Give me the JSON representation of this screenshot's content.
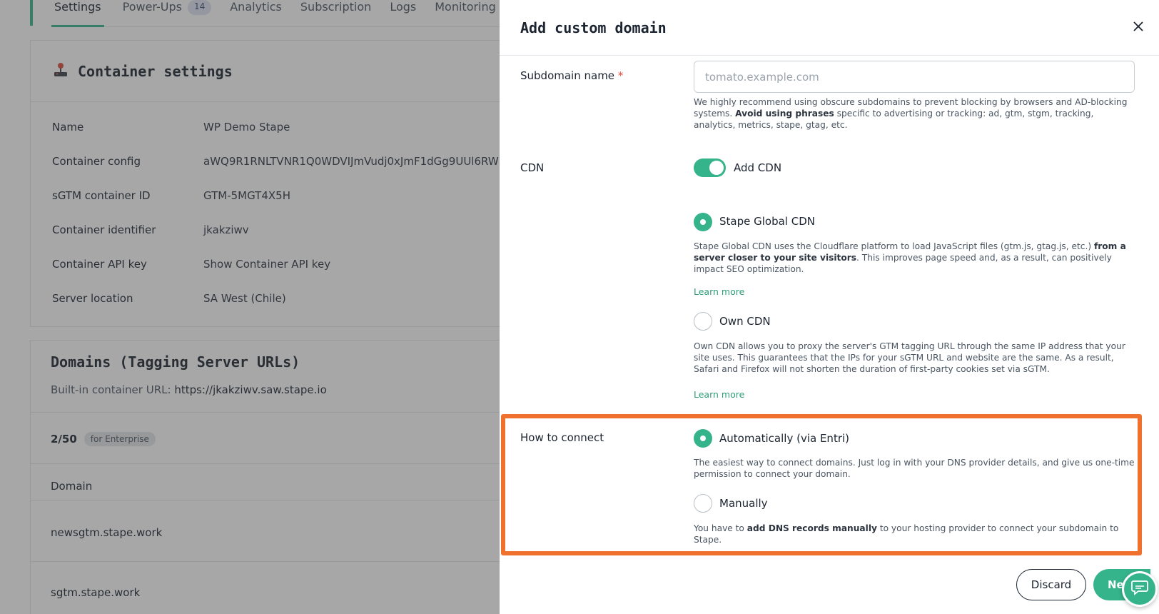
{
  "background": {
    "tabs": [
      {
        "label": "Settings",
        "active": true
      },
      {
        "label": "Power-Ups",
        "count": "14"
      },
      {
        "label": "Analytics"
      },
      {
        "label": "Subscription"
      },
      {
        "label": "Logs"
      },
      {
        "label": "Monitoring"
      }
    ],
    "container_settings": {
      "title": "Container settings",
      "rows": [
        {
          "key": "Name",
          "value": "WP Demo Stape"
        },
        {
          "key": "Container config",
          "value": "aWQ9R1RNLTVNR1Q0WDVIJmVudj0xJmF1dGg9UUl6RW"
        },
        {
          "key": "sGTM container ID",
          "value": "GTM-5MGT4X5H"
        },
        {
          "key": "Container identifier",
          "value": "jkakziwv"
        },
        {
          "key": "Container API key",
          "value": "Show Container API key"
        },
        {
          "key": "Server location",
          "value": "SA West (Chile)"
        }
      ]
    },
    "domains": {
      "title": "Domains (Tagging Server URLs)",
      "builtin_label": "Built-in container URL:",
      "builtin_url": "https://jkakziwv.saw.stape.io",
      "usage": "2/50",
      "plan_badge": "for Enterprise",
      "column_header": "Domain",
      "items": [
        "newsgtm.stape.work",
        "sgtm.stape.work"
      ]
    }
  },
  "modal": {
    "title": "Add custom domain",
    "subdomain": {
      "label": "Subdomain name",
      "required_mark": "*",
      "placeholder": "tomato.example.com",
      "value": "",
      "help_pre": "We highly recommend using obscure subdomains to prevent blocking by browsers and AD-blocking systems. ",
      "help_bold": "Avoid using phrases",
      "help_post": " specific to advertising or tracking: ad, gtm, stgm, tracking, analytics, metrics, stape, gtag, etc."
    },
    "cdn": {
      "label": "CDN",
      "toggle_label": "Add CDN",
      "enabled": true,
      "options": [
        {
          "label": "Stape Global CDN",
          "selected": true,
          "desc_pre": "Stape Global CDN uses the Cloudflare platform to load JavaScript files (gtm.js, gtag.js, etc.) ",
          "desc_bold": "from a server closer to your site visitors",
          "desc_post": ". This improves page speed and, as a result, can positively impact SEO optimization.",
          "learn_more": "Learn more"
        },
        {
          "label": "Own CDN",
          "selected": false,
          "desc": "Own CDN allows you to proxy the server's GTM tagging URL through the same IP address that your site uses. This guarantees that the IPs for your sGTM URL and website are the same. As a result, Safari and Firefox will not shorten the duration of first-party cookies set via sGTM.",
          "learn_more": "Learn more"
        }
      ]
    },
    "connect": {
      "label": "How to connect",
      "options": [
        {
          "label": "Automatically (via Entri)",
          "selected": true,
          "desc": "The easiest way to connect domains. Just log in with your DNS provider details, and give us one-time permission to connect your domain."
        },
        {
          "label": "Manually",
          "selected": false,
          "desc_pre": "You have to ",
          "desc_bold": "add DNS records manually",
          "desc_post": " to your hosting provider to connect your subdomain to Stape."
        }
      ]
    },
    "buttons": {
      "discard": "Discard",
      "next": "Ne"
    },
    "colors": {
      "accent": "#35b38a",
      "highlight": "#f0702e"
    }
  }
}
